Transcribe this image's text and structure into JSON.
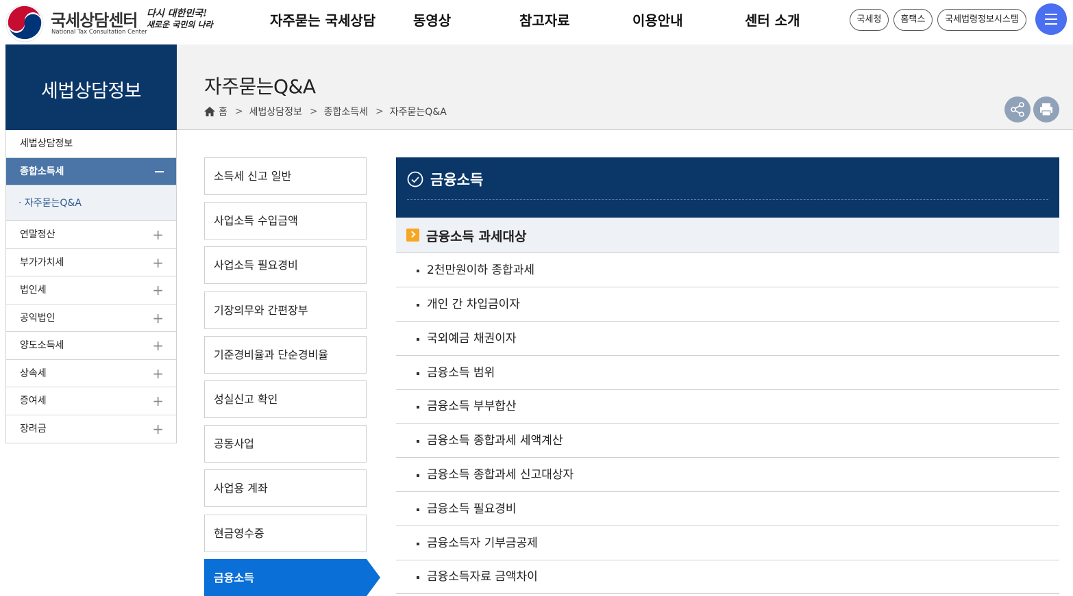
{
  "header": {
    "logo_name": "국세상담센터",
    "logo_english": "National Tax Consultation Center",
    "slogan_line1": "다시 대한민국!",
    "slogan_line2": "새로운 국민의 나라",
    "nav": [
      "자주묻는 국세상담",
      "동영상",
      "참고자료",
      "이용안내",
      "센터 소개"
    ],
    "utility": [
      "국세청",
      "홈택스",
      "국세법령정보시스템"
    ],
    "menu_icon": "hamburger-icon"
  },
  "sidebar": {
    "title": "세법상담정보",
    "items": [
      {
        "label": "세법상담정보"
      },
      {
        "label": "종합소득세",
        "active": true
      },
      {
        "label": "연말정산"
      },
      {
        "label": "부가가치세"
      },
      {
        "label": "법인세"
      },
      {
        "label": "공익법인"
      },
      {
        "label": "양도소득세"
      },
      {
        "label": "상속세"
      },
      {
        "label": "증여세"
      },
      {
        "label": "장려금"
      }
    ],
    "sub_item": "자주묻는Q&A"
  },
  "page": {
    "title": "자주묻는Q&A",
    "breadcrumb": [
      "홈",
      "세법상담정보",
      "종합소득세",
      "자주묻는Q&A"
    ]
  },
  "categories": [
    "소득세 신고 일반",
    "사업소득 수입금액",
    "사업소득 필요경비",
    "기장의무와 간편장부",
    "기준경비율과 단순경비율",
    "성실신고 확인",
    "공동사업",
    "사업용 계좌",
    "현금영수증",
    "금융소득"
  ],
  "active_category": "금융소득",
  "panel": {
    "title": "금융소득",
    "subtitle": "금융소득 과세대상",
    "questions": [
      "2천만원이하 종합과세",
      "개인 간 차입금이자",
      "국외예금 채권이자",
      "금융소득 범위",
      "금융소득 부부합산",
      "금융소득 종합과세 세액계산",
      "금융소득 종합과세 신고대상자",
      "금융소득 필요경비",
      "금융소득자 기부금공제",
      "금융소득자료 금액차이"
    ]
  },
  "colors": {
    "navy": "#0a3668",
    "active_blue": "#0a6fd6",
    "sidebar_active": "#4a75a6",
    "accent_orange": "#f5a623",
    "menu_button": "#4a6ff0"
  }
}
